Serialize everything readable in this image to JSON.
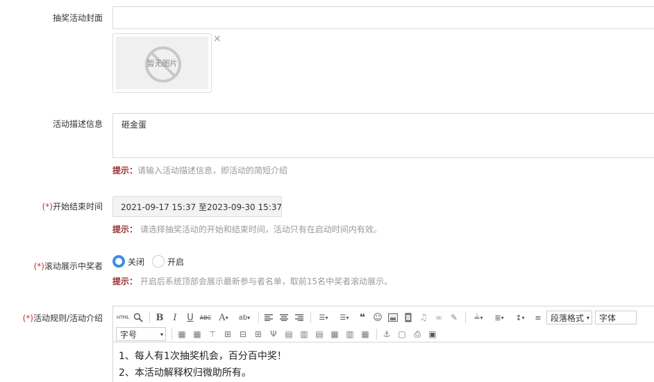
{
  "cover": {
    "label": "抽奖活动封面",
    "placeholder_text": "暂无图片",
    "remove_icon": "×"
  },
  "description": {
    "label": "活动描述信息",
    "value": "砸金蛋",
    "hint_key": "提示：",
    "hint_text": "请输入活动描述信息，即活动的简短介绍"
  },
  "time_range": {
    "required_mark": "(*)",
    "label": "开始结束时间",
    "value": "2021-09-17 15:37 至2023-09-30 15:37",
    "hint_key": "提示：",
    "hint_text": " 请选择抽奖活动的开始和结束时间，活动只有在启动时间内有效。"
  },
  "scroll_winners": {
    "required_mark": "(*)",
    "label": "滚动展示中奖者",
    "options": [
      {
        "label": "关闭",
        "checked": true
      },
      {
        "label": "开启",
        "checked": false
      }
    ],
    "hint_key": "提示：",
    "hint_text": " 开启后系统顶部会展示最新参与者名单，取前15名中奖者滚动展示。"
  },
  "rules": {
    "required_mark": "(*)",
    "label": "活动规则/活动介绍",
    "toolbar": {
      "html_label": "HTML",
      "paragraph_format": "段落格式",
      "font_family": "字体",
      "font_size": "字号"
    },
    "content": [
      "1、每人有1次抽奖机会，百分百中奖！",
      "2、本活动解释权归微助所有。"
    ]
  },
  "colors": {
    "accent": "#3a8ee6",
    "required": "#c9302c",
    "hint_key": "#9b2c2c",
    "hint_text": "#999999"
  }
}
